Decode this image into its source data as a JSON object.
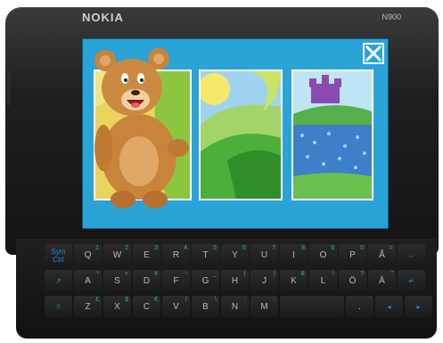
{
  "device": {
    "brand": "NOKIA",
    "model": "N900"
  },
  "app": {
    "close_icon": "close-x-icon",
    "colors": {
      "background": "#2aa3d6",
      "frame": "#ffffff"
    },
    "panels": [
      {
        "id": "panel-1",
        "scene": "yellow-field"
      },
      {
        "id": "panel-2",
        "scene": "green-hills"
      },
      {
        "id": "panel-3",
        "scene": "castle-pond"
      }
    ],
    "character": "teddy-bear"
  },
  "keyboard": {
    "rows": [
      [
        {
          "l": "Sym\nCtrl",
          "fn": true
        },
        {
          "l": "Q",
          "s": "1"
        },
        {
          "l": "W",
          "s": "2"
        },
        {
          "l": "E",
          "s": "3"
        },
        {
          "l": "R",
          "s": "4"
        },
        {
          "l": "T",
          "s": "5"
        },
        {
          "l": "Y",
          "s": "6"
        },
        {
          "l": "U",
          "s": "7"
        },
        {
          "l": "I",
          "s": "8"
        },
        {
          "l": "O",
          "s": "9"
        },
        {
          "l": "P",
          "s": "0"
        },
        {
          "l": "Å",
          "s": "="
        },
        {
          "l": "←",
          "fn": true
        }
      ],
      [
        {
          "l": "↗",
          "fn": true
        },
        {
          "l": "A",
          "s": "*"
        },
        {
          "l": "S",
          "s": "+"
        },
        {
          "l": "D",
          "s": "#"
        },
        {
          "l": "F",
          "s": "-"
        },
        {
          "l": "G",
          "s": "_"
        },
        {
          "l": "H",
          "s": "("
        },
        {
          "l": "J",
          "s": ")"
        },
        {
          "l": "K",
          "s": "&"
        },
        {
          "l": "L",
          "s": "!"
        },
        {
          "l": "Ö",
          "s": "?"
        },
        {
          "l": "Ä",
          "s": "\""
        },
        {
          "l": "↵",
          "fn": true
        }
      ],
      [
        {
          "l": "⇧",
          "fn": true
        },
        {
          "l": "Z",
          "s": "£"
        },
        {
          "l": "X",
          "s": "$"
        },
        {
          "l": "C",
          "s": "€"
        },
        {
          "l": "V",
          "s": "/"
        },
        {
          "l": "B",
          "s": "\\"
        },
        {
          "l": "N",
          "s": ":"
        },
        {
          "l": "M",
          "s": ";"
        },
        {
          "l": "",
          "space": true
        },
        {
          "l": ".",
          "s": "'"
        },
        {
          "l": "◂",
          "fn": true
        },
        {
          "l": "▸",
          "fn": true
        }
      ]
    ]
  }
}
